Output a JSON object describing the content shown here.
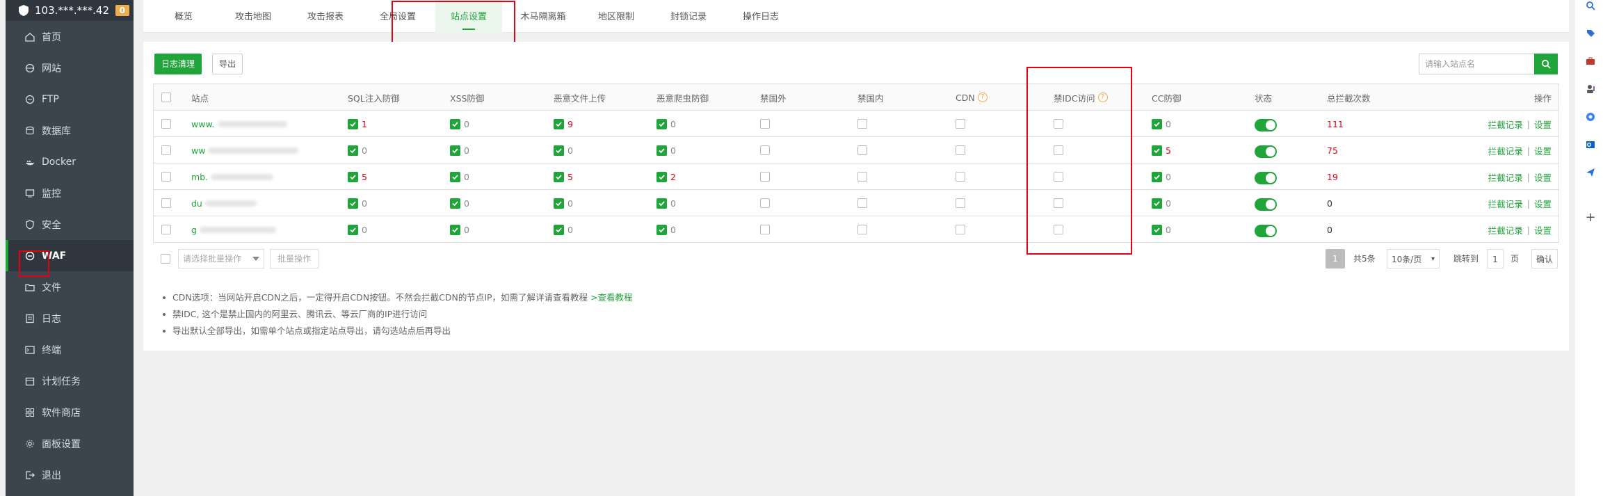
{
  "sidebar": {
    "server": "103.***.***.42",
    "badge": "0",
    "items": [
      {
        "label": "首页",
        "icon": "home-icon"
      },
      {
        "label": "网站",
        "icon": "globe-icon"
      },
      {
        "label": "FTP",
        "icon": "ftp-icon"
      },
      {
        "label": "数据库",
        "icon": "database-icon"
      },
      {
        "label": "Docker",
        "icon": "docker-icon"
      },
      {
        "label": "监控",
        "icon": "monitor-icon"
      },
      {
        "label": "安全",
        "icon": "shield-icon"
      },
      {
        "label": "WAF",
        "icon": "waf-icon"
      },
      {
        "label": "文件",
        "icon": "folder-icon"
      },
      {
        "label": "日志",
        "icon": "log-icon"
      },
      {
        "label": "终端",
        "icon": "terminal-icon"
      },
      {
        "label": "计划任务",
        "icon": "calendar-icon"
      },
      {
        "label": "软件商店",
        "icon": "store-icon"
      },
      {
        "label": "面板设置",
        "icon": "gear-icon"
      },
      {
        "label": "退出",
        "icon": "logout-icon"
      }
    ],
    "active_index": 7
  },
  "tabs": [
    "概览",
    "攻击地图",
    "攻击报表",
    "全局设置",
    "站点设置",
    "木马隔离箱",
    "地区限制",
    "封锁记录",
    "操作日志"
  ],
  "active_tab": 4,
  "toolbar": {
    "clear_log": "日志清理",
    "export": "导出",
    "search_placeholder": "请输入站点名"
  },
  "table": {
    "headers": {
      "site": "站点",
      "sql": "SQL注入防御",
      "xss": "XSS防御",
      "upload": "恶意文件上传",
      "crawler": "恶意爬虫防御",
      "foreign": "禁国外",
      "domestic": "禁国内",
      "cdn": "CDN",
      "idc": "禁IDC访问",
      "cc": "CC防御",
      "status": "状态",
      "total": "总拦截次数",
      "ops": "操作"
    },
    "rows": [
      {
        "site": "www.",
        "sql": "1",
        "xss": "0",
        "upload": "9",
        "crawler": "0",
        "cc": "0",
        "total": "111"
      },
      {
        "site": "ww",
        "sql": "0",
        "xss": "0",
        "upload": "0",
        "crawler": "0",
        "cc": "5",
        "total": "75"
      },
      {
        "site": "mb.",
        "sql": "5",
        "xss": "0",
        "upload": "5",
        "crawler": "2",
        "cc": "0",
        "total": "19"
      },
      {
        "site": "du",
        "sql": "0",
        "xss": "0",
        "upload": "0",
        "crawler": "0",
        "cc": "0",
        "total": "0"
      },
      {
        "site": "g",
        "sql": "0",
        "xss": "0",
        "upload": "0",
        "crawler": "0",
        "cc": "0",
        "total": "0"
      }
    ],
    "op_records": "拦截记录",
    "op_sep": "|",
    "op_settings": "设置"
  },
  "batch": {
    "select_placeholder": "请选择批量操作",
    "button": "批量操作"
  },
  "pager": {
    "page": "1",
    "total": "共5条",
    "per_page": "10条/页",
    "goto": "跳转到",
    "goto_value": "1",
    "page_unit": "页",
    "confirm": "确认"
  },
  "notes": {
    "cdn_text": "CDN选项：当网站开启CDN之后，一定得开启CDN按钮。不然会拦截CDN的节点IP，如需了解详请查看教程",
    "cdn_link": ">查看教程",
    "idc": "禁IDC, 这个是禁止国内的阿里云、腾讯云、等云厂商的IP进行访问",
    "export": "导出默认全部导出，如需单个站点或指定站点导出，请勾选站点后再导出"
  },
  "colors": {
    "accent": "#20a53a",
    "danger": "#e60012",
    "sidebar": "#3c444d",
    "warn": "#f0ad4e"
  }
}
